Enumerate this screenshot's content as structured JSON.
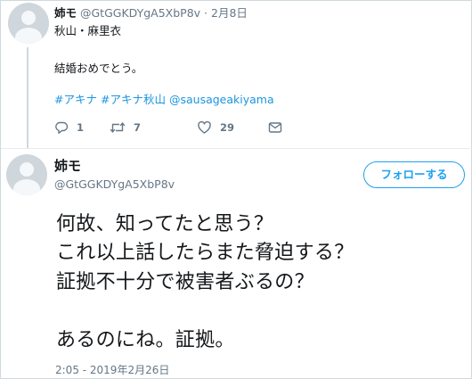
{
  "parent_tweet": {
    "name": "姉モ",
    "handle": "@GtGGKDYgA5XbP8v",
    "separator": "·",
    "date": "2月8日",
    "line1": "秋山・麻里衣",
    "line2": "結婚おめでとう。",
    "tags": [
      "#アキナ",
      "#アキナ秋山",
      "@sausageakiyama"
    ],
    "actions": {
      "reply_count": "1",
      "retweet_count": "7",
      "like_count": "29"
    }
  },
  "main_tweet": {
    "name": "姉モ",
    "handle": "@GtGGKDYgA5XbP8v",
    "follow_label": "フォローする",
    "lines": [
      "何故、知ってたと思う？",
      "これ以上話したらまた脅迫する？",
      "証拠不十分で被害者ぶるの？",
      "あるのにね。証拠。"
    ],
    "timestamp": "2:05 - 2019年2月26日"
  },
  "colors": {
    "accent": "#1da1f2",
    "link": "#1b95e0",
    "muted": "#657786",
    "text": "#14171a"
  }
}
